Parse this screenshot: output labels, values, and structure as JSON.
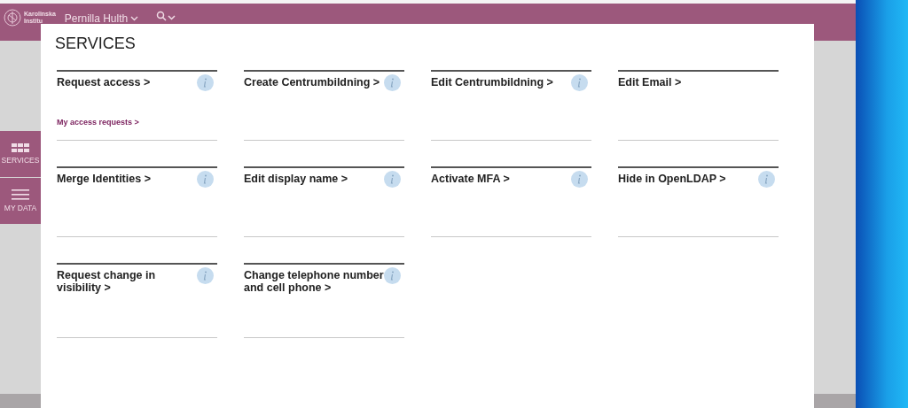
{
  "header": {
    "logo_text": [
      "Karolinska",
      "Institu"
    ],
    "user": "Pernilla Hulth"
  },
  "sidebar": {
    "items": [
      {
        "label": "SERVICES",
        "kind": "grid"
      },
      {
        "label": "MY DATA",
        "kind": "lines"
      }
    ]
  },
  "dialog": {
    "title": "SERVICES",
    "services": [
      {
        "title": "Request access >",
        "info": true,
        "link": "My access requests >"
      },
      {
        "title": "Create Centrumbildning >",
        "info": true
      },
      {
        "title": "Edit Centrumbildning >",
        "info": true
      },
      {
        "title": "Edit Email >",
        "info": false
      },
      {
        "title": "Merge Identities >",
        "info": true
      },
      {
        "title": "Edit display name >",
        "info": true
      },
      {
        "title": "Activate MFA >",
        "info": true
      },
      {
        "title": "Hide in OpenLDAP >",
        "info": true
      },
      {
        "title": "Request change in visibility >",
        "info": true
      },
      {
        "title": "Change telephone number and cell phone >",
        "info": true
      }
    ]
  }
}
